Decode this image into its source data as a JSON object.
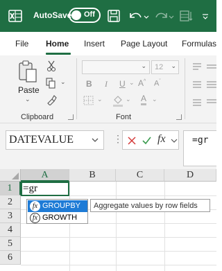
{
  "titlebar": {
    "autosave_label": "AutoSave",
    "autosave_state": "Off",
    "bg_color": "#1f6e43"
  },
  "ribbon_tabs": [
    {
      "label": "File"
    },
    {
      "label": "Home",
      "active": true
    },
    {
      "label": "Insert"
    },
    {
      "label": "Page Layout"
    },
    {
      "label": "Formulas"
    }
  ],
  "ribbon": {
    "clipboard": {
      "paste_label": "Paste",
      "group_label": "Clipboard"
    },
    "font": {
      "font_size": "12",
      "group_label": "Font"
    },
    "icons": [
      "paste-icon",
      "cut-icon",
      "copy-icon",
      "format-painter-icon",
      "bold-icon",
      "italic-icon",
      "underline-icon",
      "grow-font-icon",
      "shrink-font-icon",
      "borders-icon",
      "fill-color-icon",
      "font-color-icon",
      "align-icon"
    ]
  },
  "formula_bar": {
    "name_box": "DATEVALUE",
    "formula": "=gr",
    "cancel_icon": "cancel-icon",
    "enter_icon": "enter-icon",
    "fx_label": "fx"
  },
  "grid": {
    "columns": [
      "A",
      "B",
      "C",
      "D"
    ],
    "rows": [
      "1",
      "2",
      "3",
      "4",
      "5",
      "6"
    ],
    "active_cell_text": "=gr",
    "accent_color": "#1f6e43"
  },
  "autocomplete": {
    "items": [
      {
        "name": "GROUPBY",
        "highlighted": true
      },
      {
        "name": "GROWTH",
        "highlighted": false
      }
    ],
    "tooltip": "Aggregate values by row fields",
    "highlight_color": "#1e7bd6"
  }
}
